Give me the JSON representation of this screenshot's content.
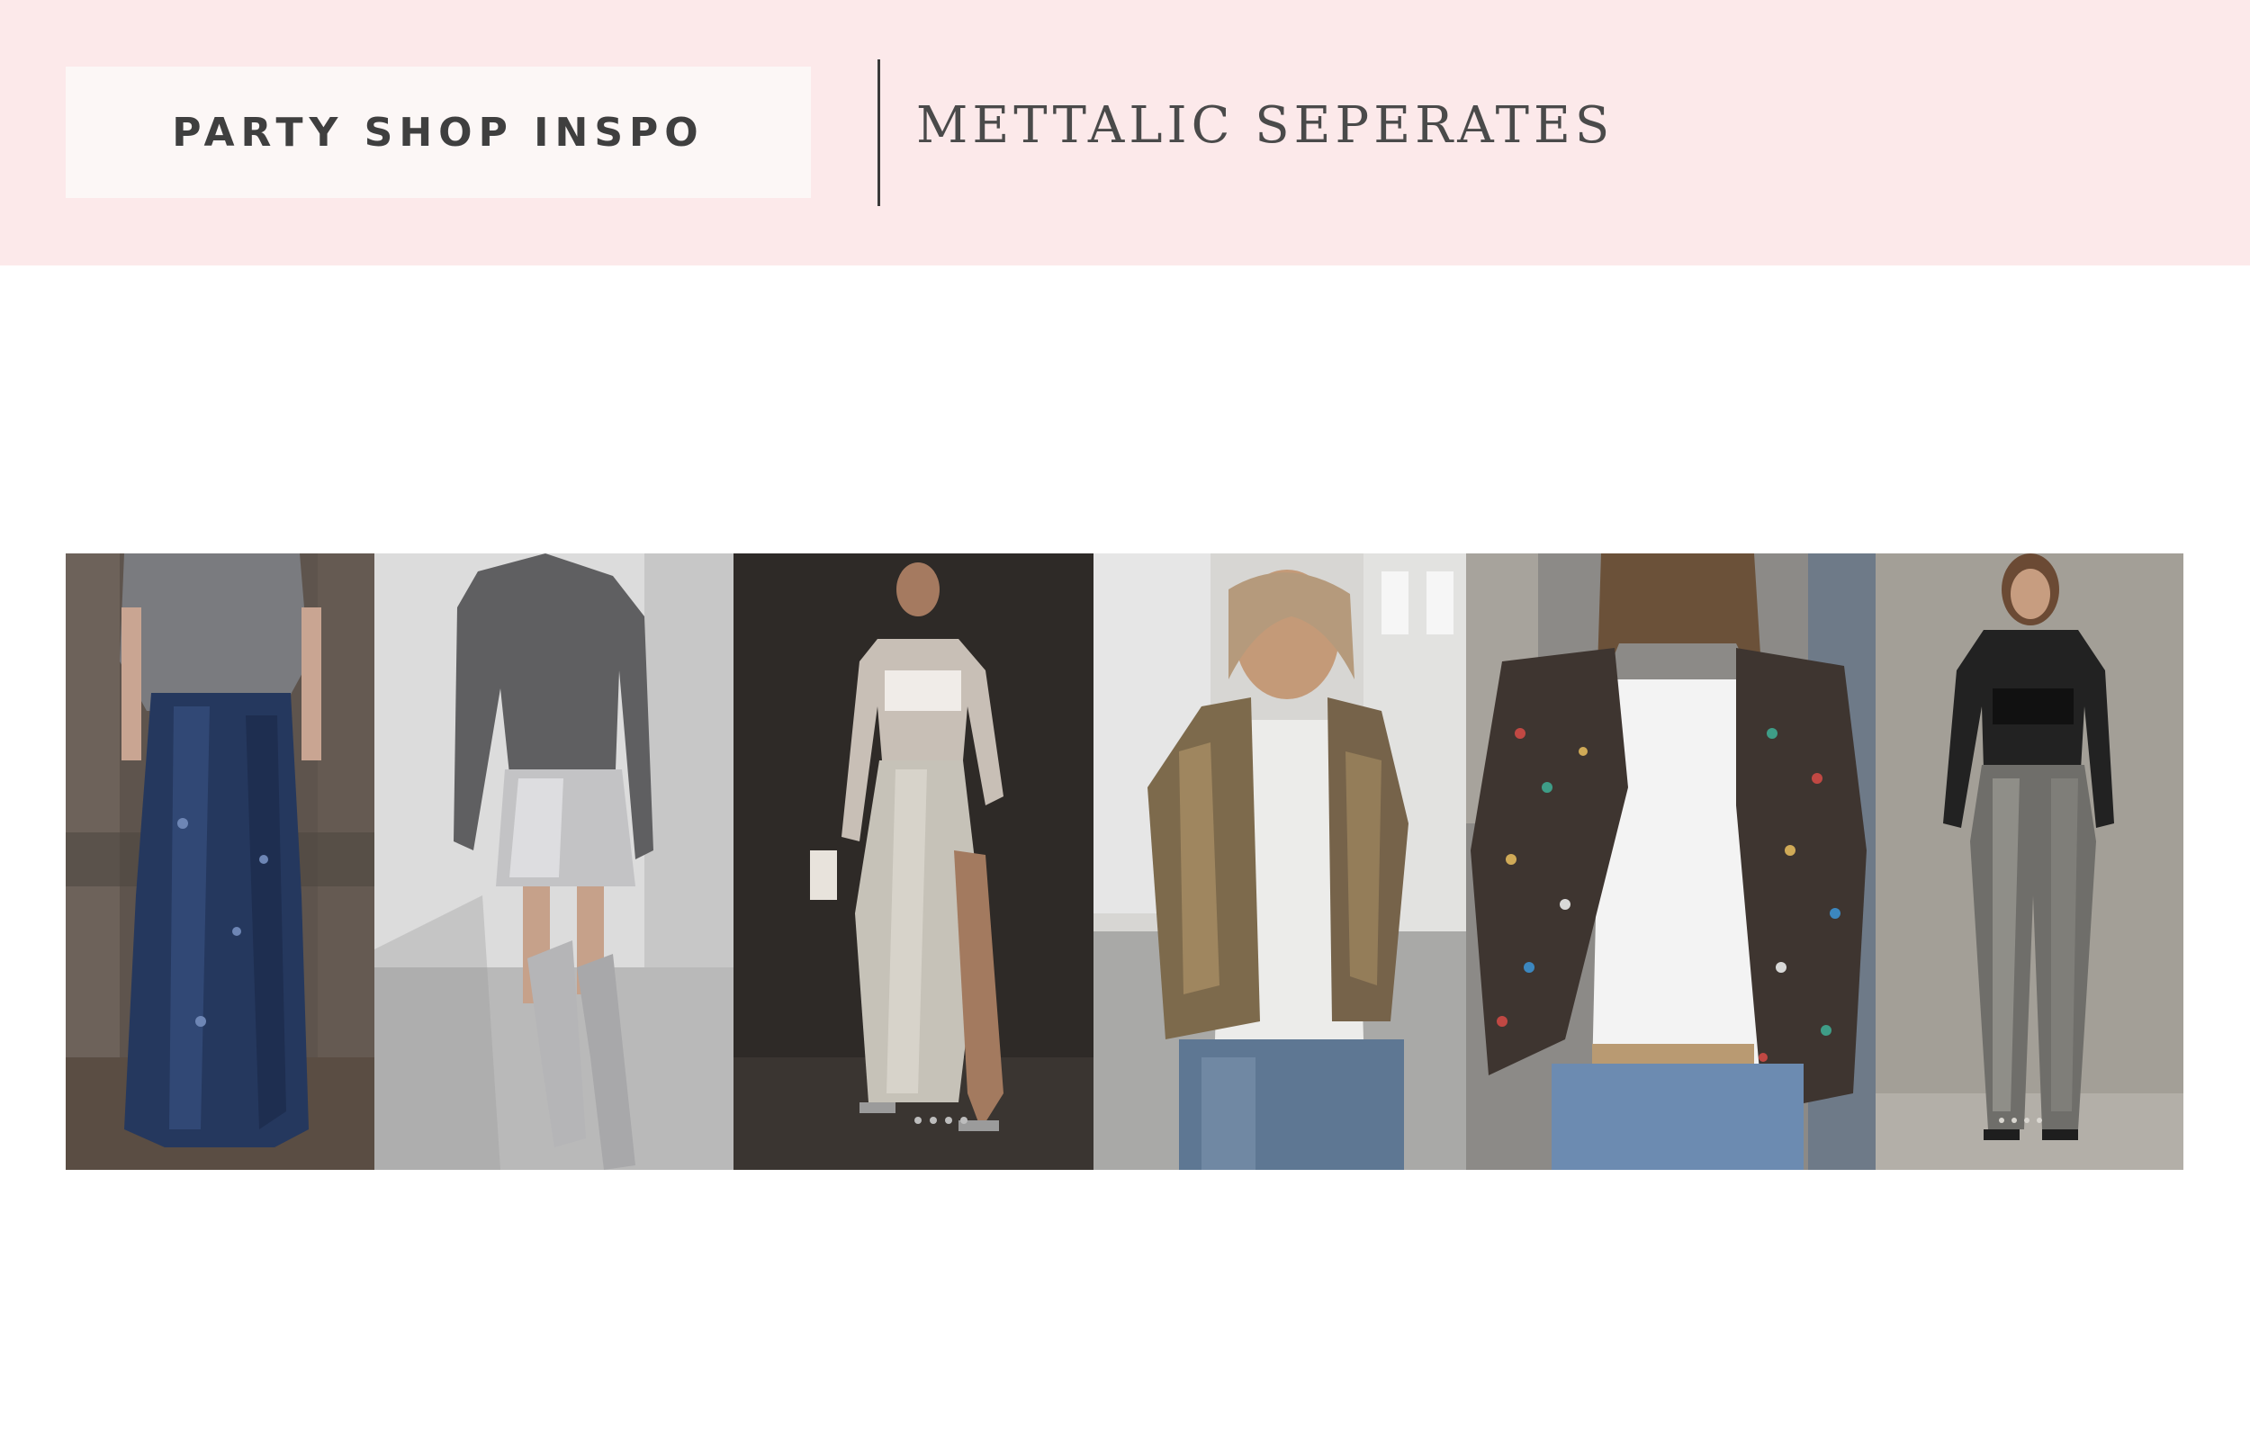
{
  "header": {
    "label": "PARTY SHOP INSPO",
    "title": "METTALIC SEPERATES"
  },
  "gallery": {
    "photos": [
      {
        "name": "photo-sequin-maxi-skirt",
        "depicts": "navy sequin maxi skirt with grey tee"
      },
      {
        "name": "photo-silver-mini-skirt",
        "depicts": "grey sweater, silver metallic mini skirt and silver knee boots"
      },
      {
        "name": "photo-silver-midi-skirt",
        "depicts": "sheer top and silver satin midi skirt with slit"
      },
      {
        "name": "photo-gold-sequin-jacket",
        "depicts": "gold sequin jacket with white tee and jeans"
      },
      {
        "name": "photo-multicolor-sequin-jacket",
        "depicts": "multicolor sequin jacket with white tee and jeans"
      },
      {
        "name": "photo-metallic-trousers",
        "depicts": "black lace top with metallic pewter trousers"
      }
    ]
  },
  "colors": {
    "banner_bg": "#fce9ea",
    "label_bg": "#fcf7f6",
    "text": "#3f3f3f"
  }
}
